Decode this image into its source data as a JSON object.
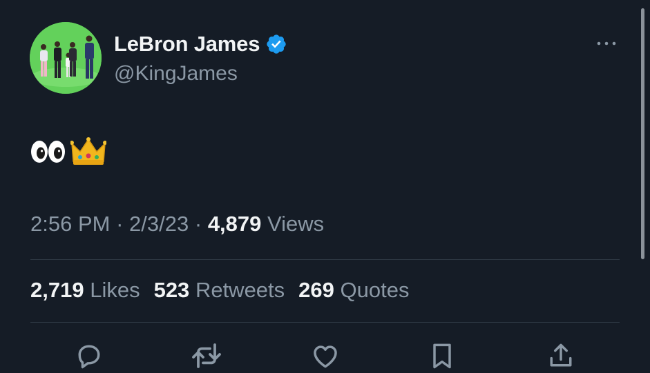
{
  "tweet": {
    "author": {
      "display_name": "LeBron James",
      "handle": "@KingJames",
      "verified": true,
      "avatar": "avatar-group-photo-green-background",
      "verified_color": "#1d9bf0"
    },
    "text_emojis": "👀👑",
    "meta": {
      "time": "2:56 PM",
      "separator": "·",
      "date": "2/3/23",
      "views_count": "4,879",
      "views_label": "Views"
    },
    "stats": [
      {
        "count": "2,719",
        "label": "Likes"
      },
      {
        "count": "523",
        "label": "Retweets"
      },
      {
        "count": "269",
        "label": "Quotes"
      }
    ],
    "actions": [
      {
        "name": "reply",
        "icon": "speech-bubble-icon"
      },
      {
        "name": "retweet",
        "icon": "retweet-icon"
      },
      {
        "name": "like",
        "icon": "heart-icon"
      },
      {
        "name": "bookmark",
        "icon": "bookmark-icon"
      },
      {
        "name": "share",
        "icon": "share-icon"
      }
    ],
    "more_icon": "more-horizontal-icon"
  },
  "colors": {
    "background": "#151c26",
    "primary_text": "#f2f4f5",
    "secondary_text": "#8b98a5",
    "divider": "#2f3a45",
    "accent": "#1d9bf0"
  }
}
